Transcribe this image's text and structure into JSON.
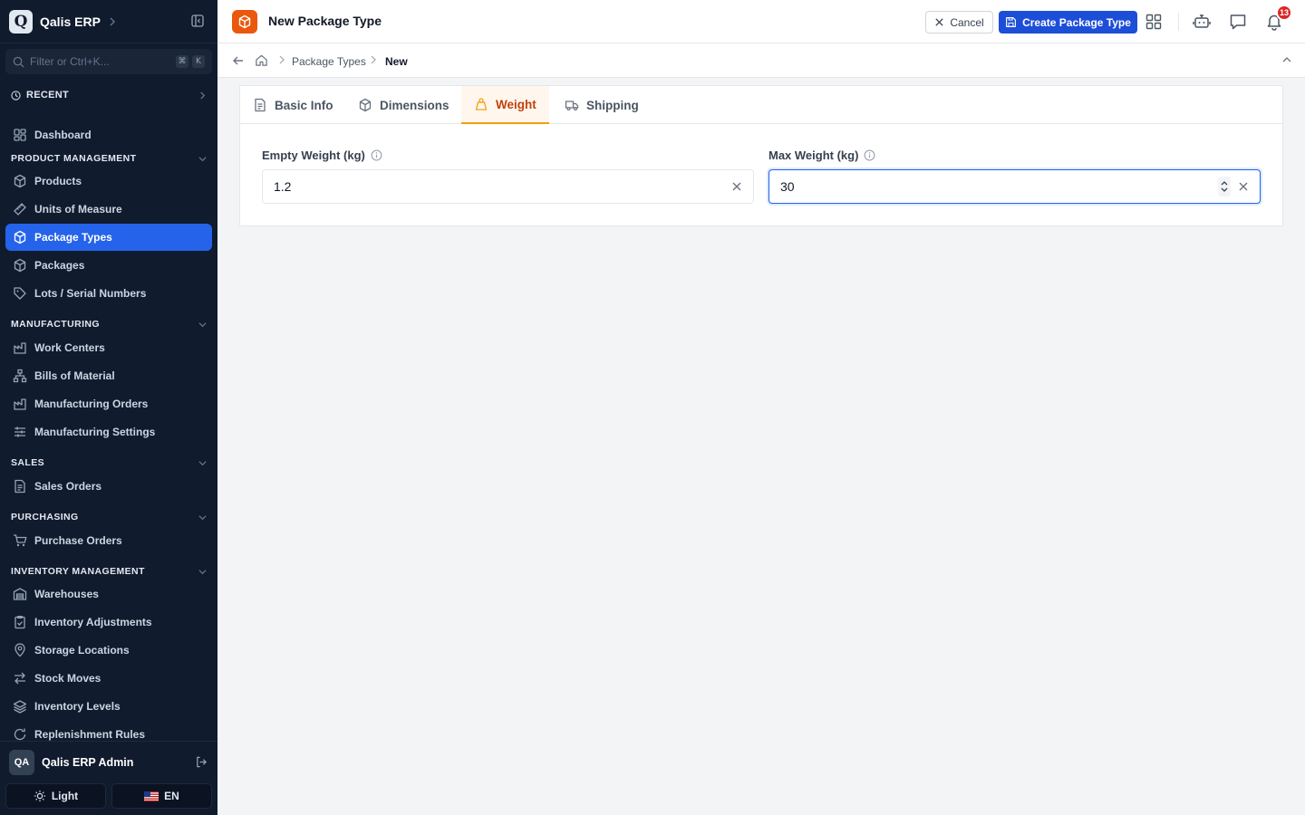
{
  "app": {
    "name": "Qalis ERP",
    "logo_letter": "Q"
  },
  "sidebar": {
    "filter_placeholder": "Filter or Ctrl+K...",
    "filter_kbd": [
      "⌘",
      "K"
    ],
    "recent_label": "RECENT",
    "items": [
      {
        "label": "Dashboard",
        "icon": "dashboard-icon"
      },
      {
        "label": "Products",
        "icon": "box-icon"
      },
      {
        "label": "Units of Measure",
        "icon": "ruler-icon"
      },
      {
        "label": "Package Types",
        "icon": "box-icon",
        "active": true
      },
      {
        "label": "Packages",
        "icon": "box-icon"
      },
      {
        "label": "Lots / Serial Numbers",
        "icon": "tag-icon"
      },
      {
        "label": "Work Centers",
        "icon": "factory-icon"
      },
      {
        "label": "Bills of Material",
        "icon": "hierarchy-icon"
      },
      {
        "label": "Manufacturing Orders",
        "icon": "factory-icon"
      },
      {
        "label": "Manufacturing Settings",
        "icon": "sliders-icon"
      },
      {
        "label": "Sales Orders",
        "icon": "document-icon"
      },
      {
        "label": "Purchase Orders",
        "icon": "cart-icon"
      },
      {
        "label": "Warehouses",
        "icon": "warehouse-icon"
      },
      {
        "label": "Inventory Adjustments",
        "icon": "clipboard-check-icon"
      },
      {
        "label": "Storage Locations",
        "icon": "map-pin-icon"
      },
      {
        "label": "Stock Moves",
        "icon": "arrows-swap-icon"
      },
      {
        "label": "Inventory Levels",
        "icon": "layers-icon"
      },
      {
        "label": "Replenishment Rules",
        "icon": "refresh-icon"
      }
    ],
    "sections": [
      {
        "label": "PRODUCT MANAGEMENT"
      },
      {
        "label": "MANUFACTURING"
      },
      {
        "label": "SALES"
      },
      {
        "label": "PURCHASING"
      },
      {
        "label": "INVENTORY MANAGEMENT"
      }
    ],
    "user": {
      "initials": "QA",
      "name": "Qalis ERP Admin"
    },
    "theme_label": "Light",
    "lang_label": "EN"
  },
  "header": {
    "title": "New Package Type",
    "cancel_label": "Cancel",
    "create_label": "Create Package Type",
    "notification_count": "13"
  },
  "breadcrumb": {
    "parent": "Package Types",
    "current": "New"
  },
  "tabs": [
    {
      "label": "Basic Info",
      "icon": "document-icon"
    },
    {
      "label": "Dimensions",
      "icon": "box-icon"
    },
    {
      "label": "Weight",
      "icon": "weight-icon",
      "active": true
    },
    {
      "label": "Shipping",
      "icon": "truck-icon"
    }
  ],
  "form": {
    "empty_weight": {
      "label": "Empty Weight (kg)",
      "value": "1.2"
    },
    "max_weight": {
      "label": "Max Weight (kg)",
      "value": "30"
    }
  },
  "colors": {
    "sidebar_bg": "#111b2e",
    "primary": "#1d4ed8",
    "accent_orange": "#ea580c",
    "notification_red": "#dc2626"
  }
}
